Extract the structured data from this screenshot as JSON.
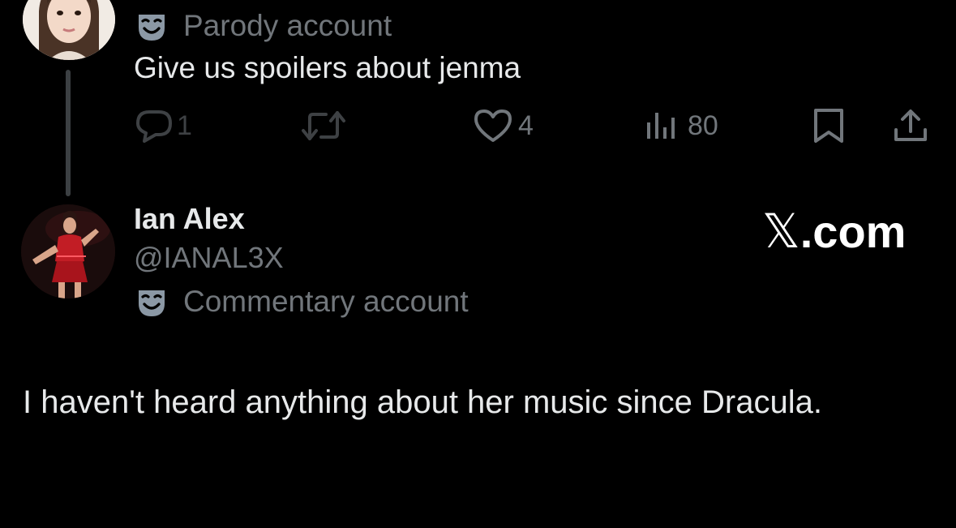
{
  "parent_tweet": {
    "account_label": "Parody account",
    "text": "Give us spoilers about jenma",
    "actions": {
      "reply_count": "1",
      "like_count": "4",
      "views_count": "80"
    }
  },
  "reply_tweet": {
    "display_name": "Ian Alex",
    "handle": "@IANAL3X",
    "account_label": "Commentary account",
    "text": "I haven't heard anything about her music since Dracula."
  },
  "watermark": {
    "x_glyph": "𝕏",
    "domain": ".com"
  },
  "icons": {
    "account_label": "theater-mask-icon",
    "reply": "speech-bubble-icon",
    "retweet": "retweet-icon",
    "like": "heart-icon",
    "views": "bar-chart-icon",
    "bookmark": "bookmark-icon",
    "share": "share-upload-icon"
  },
  "colors": {
    "background": "#000000",
    "primary_text": "#e7e9ea",
    "secondary_text": "#71767b",
    "thread_line": "#3c4043",
    "mask_icon": "#8b98a5"
  }
}
